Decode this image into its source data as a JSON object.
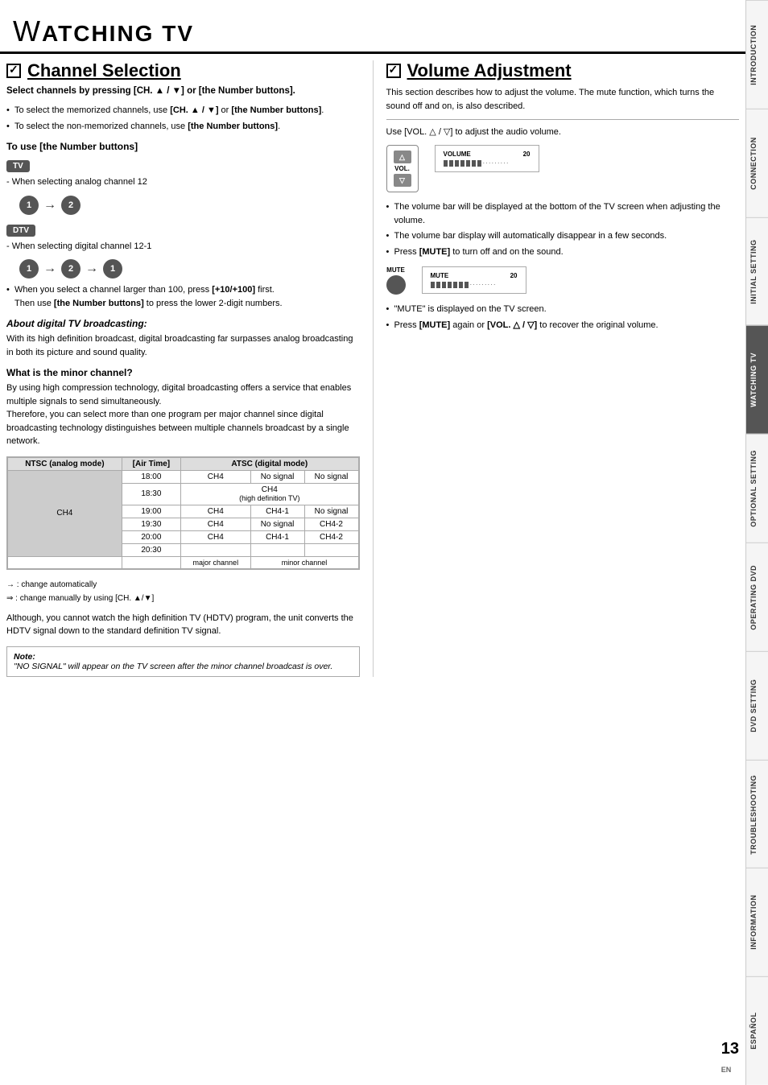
{
  "header": {
    "title": "ATCHING TV",
    "w_letter": "W"
  },
  "tabs": [
    {
      "label": "INTRODUCTION",
      "active": false
    },
    {
      "label": "CONNECTION",
      "active": false
    },
    {
      "label": "INITIAL SETTING",
      "active": false
    },
    {
      "label": "WATCHING TV",
      "active": true
    },
    {
      "label": "OPTIONAL SETTING",
      "active": false
    },
    {
      "label": "OPERATING DVD",
      "active": false
    },
    {
      "label": "DVD SETTING",
      "active": false
    },
    {
      "label": "TROUBLESHOOTING",
      "active": false
    },
    {
      "label": "INFORMATION",
      "active": false
    },
    {
      "label": "ESPAÑOL",
      "active": false
    }
  ],
  "channel_section": {
    "heading": "Channel Selection",
    "intro": "Select channels by pressing [CH. ▲ / ▼] or [the Number buttons].",
    "bullets": [
      "To select the memorized channels, use [CH. ▲ / ▼] or [the Number buttons].",
      "To select the non-memorized channels, use [the Number buttons]."
    ],
    "to_use_heading": "To use [the Number buttons]",
    "tv_badge": "TV",
    "tv_note": "- When selecting analog channel 12",
    "dtv_badge": "DTV",
    "dtv_note": "- When selecting digital channel 12-1",
    "larger_channel": "When you select a channel larger than 100, press [+10/+100] first.\nThen use [the Number buttons] to press the lower 2-digit numbers.",
    "digital_heading": "About digital TV broadcasting:",
    "digital_body": "With its high definition broadcast, digital broadcasting far surpasses analog broadcasting in both its picture and sound quality.",
    "minor_heading": "What is the minor channel?",
    "minor_body": "By using high compression technology, digital broadcasting offers a service that enables multiple signals to send simultaneously.\nTherefore, you can select more than one program per major channel since digital broadcasting technology distinguishes between multiple channels broadcast by a single network.",
    "table": {
      "ntsc_label": "NTSC (analog mode)",
      "atsc_label": "ATSC (digital mode)",
      "air_time_label": "[Air Time]",
      "rows": [
        {
          "time": "18:00",
          "ntsc": "CH4",
          "atsc_cols": [
            "CH4",
            "No signal",
            "No signal"
          ]
        },
        {
          "time": "18:30",
          "ntsc": "",
          "atsc_cols": [
            "CH4 (high definition TV)",
            "",
            ""
          ]
        },
        {
          "time": "19:00",
          "ntsc": "",
          "atsc_cols": [
            "CH4",
            "CH4-1",
            "No signal"
          ]
        },
        {
          "time": "19:30",
          "ntsc": "",
          "atsc_cols": [
            "CH4",
            "No signal",
            "CH4-2"
          ]
        },
        {
          "time": "20:00",
          "ntsc": "",
          "atsc_cols": [
            "CH4",
            "CH4-1",
            "CH4-2"
          ]
        },
        {
          "time": "20:30",
          "ntsc": "",
          "atsc_cols": [
            "",
            "",
            ""
          ]
        }
      ],
      "major_label": "major channel",
      "minor_label": "minor channel"
    },
    "legend_auto": "→ : change automatically",
    "legend_manual": "⇒ : change manually by using [CH. ▲/▼]",
    "hdtv_note": "Although, you cannot watch the high definition TV (HDTV) program, the unit converts the HDTV signal down to the standard definition TV signal.",
    "note_label": "Note:",
    "note_body": "\"NO SIGNAL\" will appear on the TV screen after the minor channel broadcast is over."
  },
  "volume_section": {
    "heading": "Volume Adjustment",
    "intro": "This section describes how to adjust the volume. The mute function, which turns the sound off and on, is also described.",
    "use_vol_line": "Use [VOL. △ / ▽] to adjust the audio volume.",
    "volume": 20,
    "vol_label": "VOLUME",
    "bullets": [
      "The volume bar will be displayed at the bottom of the TV screen when adjusting the volume.",
      "The volume bar display will automatically disappear in a few seconds.",
      "Press [MUTE] to turn off and on the sound."
    ],
    "mute_label": "MUTE",
    "mute_screen_label": "MUTE",
    "mute_screen_value": 20,
    "mute_bullets": [
      "\"MUTE\" is displayed on the TV screen.",
      "Press [MUTE] again or [VOL. △ / ▽] to recover the original volume."
    ]
  },
  "page": {
    "number": "13",
    "lang": "EN"
  }
}
